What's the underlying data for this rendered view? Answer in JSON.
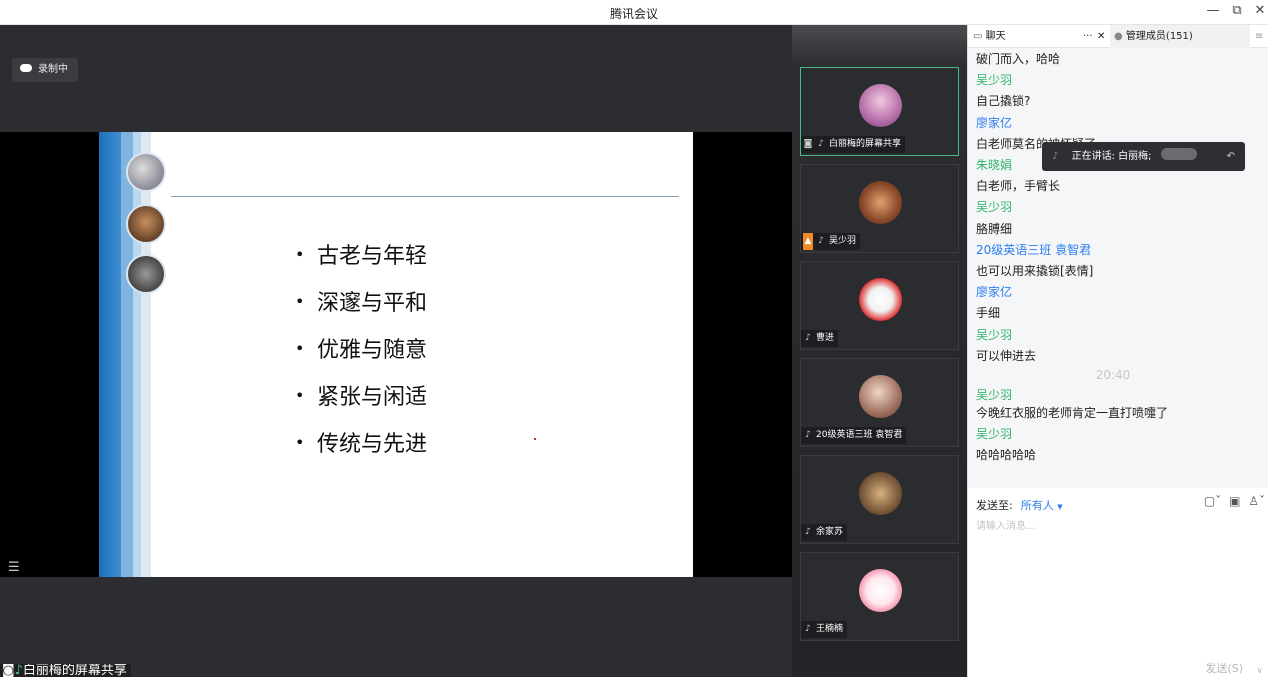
{
  "window": {
    "title": "腾讯会议",
    "minimize": "—",
    "restore": "⧉",
    "close": "✕"
  },
  "recording": {
    "label": "录制中"
  },
  "slide": {
    "bullets": [
      "古老与年轻",
      "深邃与平和",
      "优雅与随意",
      "紧张与闲适",
      "传统与先进"
    ]
  },
  "stage_label": "白丽梅的屏幕共享",
  "participants": [
    {
      "name": "白丽梅的屏幕共享",
      "active": true
    },
    {
      "name": "吴少羽"
    },
    {
      "name": "曹进"
    },
    {
      "name": "20级英语三班 袁智君"
    },
    {
      "name": "余家苏"
    },
    {
      "name": "王楠楠"
    }
  ],
  "panel": {
    "chat_tab": "聊天",
    "more": "···",
    "close": "✕",
    "members_tab": "管理成员(151)",
    "menu": "≡"
  },
  "chat": [
    {
      "kind": "txt",
      "text": "破门而入，哈哈"
    },
    {
      "kind": "name",
      "text": "吴少羽"
    },
    {
      "kind": "txt",
      "text": "自己撬锁?"
    },
    {
      "kind": "nameb",
      "text": "廖家亿"
    },
    {
      "kind": "txt",
      "text": "白老师莫名的被怀疑了"
    },
    {
      "kind": "name",
      "text": "朱晓娟"
    },
    {
      "kind": "txt",
      "text": "白老师，手臂长"
    },
    {
      "kind": "name",
      "text": "吴少羽"
    },
    {
      "kind": "txt",
      "text": "胳膊细"
    },
    {
      "kind": "nameb",
      "text": "20级英语三班 袁智君"
    },
    {
      "kind": "txt",
      "text": "也可以用来撬锁[表情]"
    },
    {
      "kind": "nameb",
      "text": "廖家亿"
    },
    {
      "kind": "txt",
      "text": "手细"
    },
    {
      "kind": "name",
      "text": "吴少羽"
    },
    {
      "kind": "txt",
      "text": "可以伸进去"
    },
    {
      "kind": "time",
      "text": "20:40"
    },
    {
      "kind": "name",
      "text": "吴少羽"
    },
    {
      "kind": "txt",
      "text": "今晚红衣服的老师肯定一直打喷嚏了"
    },
    {
      "kind": "name",
      "text": "吴少羽"
    },
    {
      "kind": "txt",
      "text": "哈哈哈哈哈"
    }
  ],
  "speaking_toast": {
    "label": "正在讲话: 白丽梅;"
  },
  "input": {
    "send_to_label": "发送至:",
    "send_to_value": "所有人",
    "placeholder": "请输入消息...",
    "send_button": "发送(S)"
  }
}
